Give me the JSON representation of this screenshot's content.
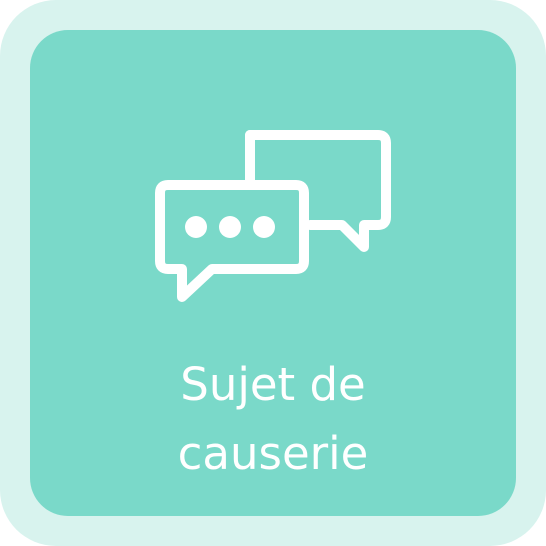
{
  "tile": {
    "label_line1": "Sujet de",
    "label_line2": "causerie",
    "icon": "chat-bubbles-icon",
    "colors": {
      "outer": "#d8f3ee",
      "inner": "#7ad9c9",
      "foreground": "#ffffff"
    }
  }
}
